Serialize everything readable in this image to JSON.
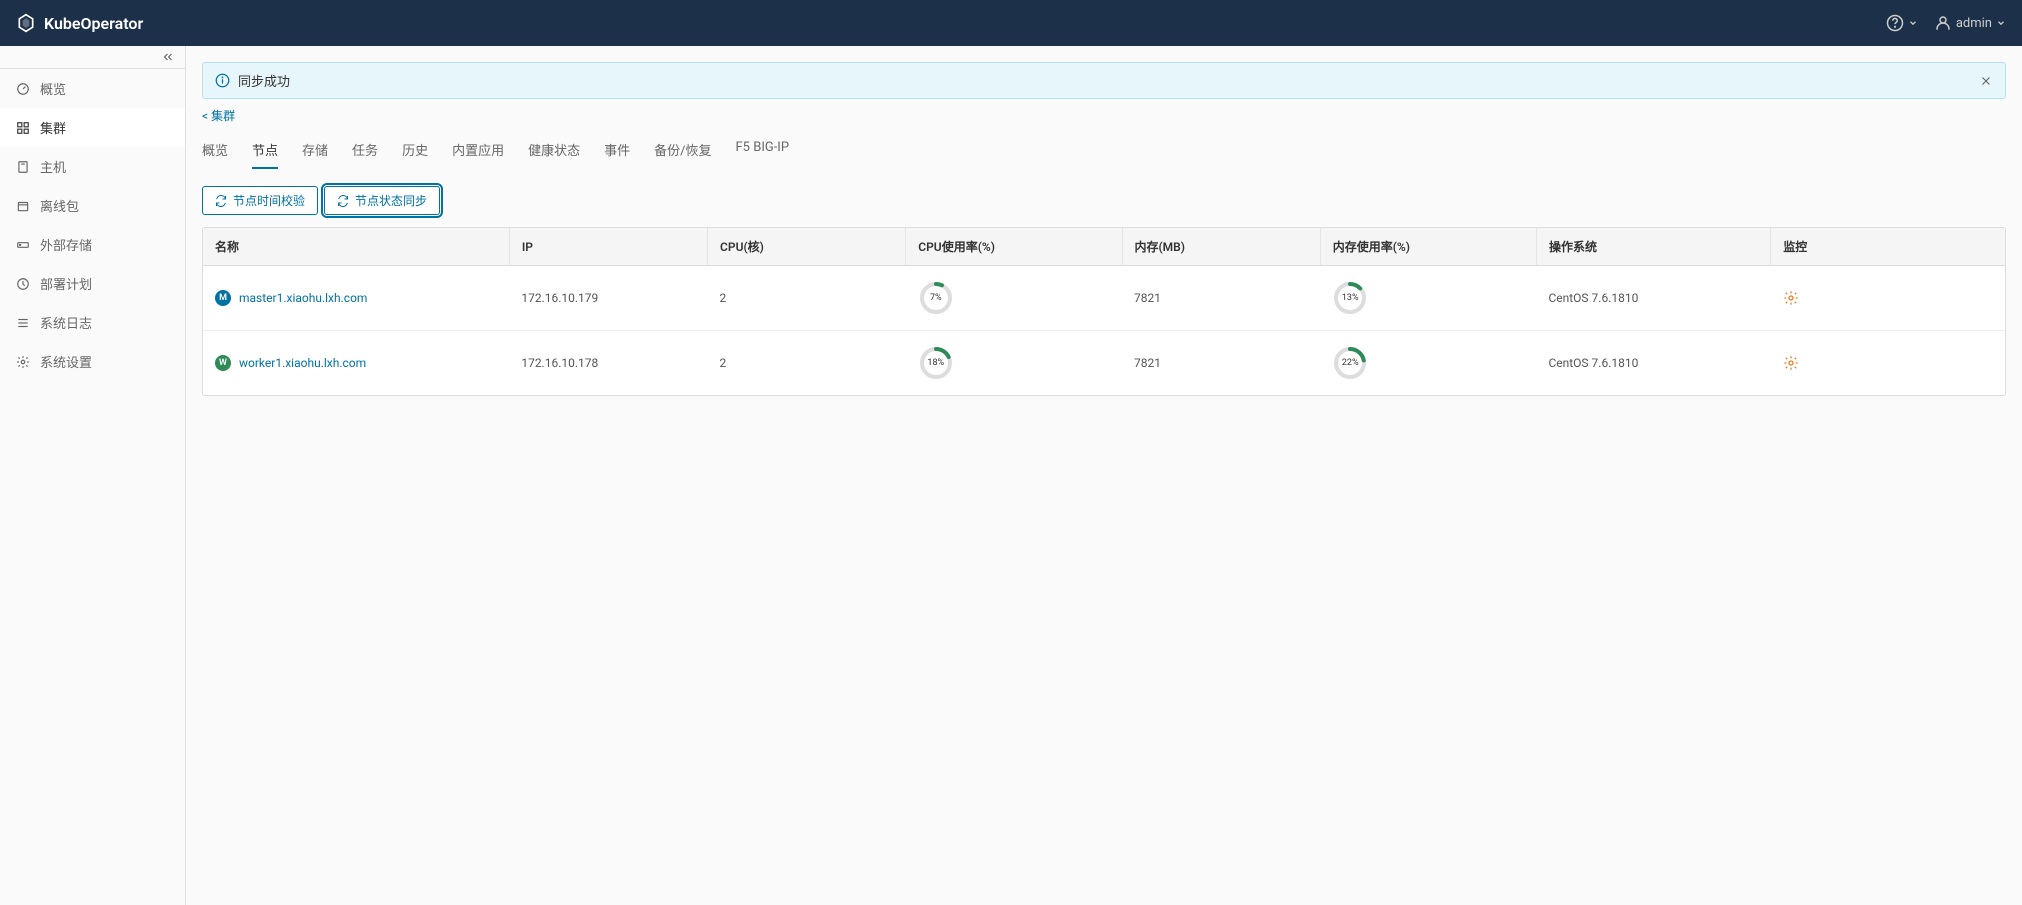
{
  "header": {
    "app_name": "KubeOperator",
    "user": "admin"
  },
  "sidebar": {
    "items": [
      {
        "label": "概览",
        "icon": "dashboard"
      },
      {
        "label": "集群",
        "icon": "cluster",
        "active": true
      },
      {
        "label": "主机",
        "icon": "host"
      },
      {
        "label": "离线包",
        "icon": "package"
      },
      {
        "label": "外部存储",
        "icon": "storage"
      },
      {
        "label": "部署计划",
        "icon": "plan"
      },
      {
        "label": "系统日志",
        "icon": "log"
      },
      {
        "label": "系统设置",
        "icon": "settings"
      }
    ]
  },
  "alert": {
    "message": "同步成功"
  },
  "breadcrumb": {
    "back_label": "< 集群"
  },
  "tabs": [
    {
      "label": "概览"
    },
    {
      "label": "节点",
      "active": true
    },
    {
      "label": "存储"
    },
    {
      "label": "任务"
    },
    {
      "label": "历史"
    },
    {
      "label": "内置应用"
    },
    {
      "label": "健康状态"
    },
    {
      "label": "事件"
    },
    {
      "label": "备份/恢复"
    },
    {
      "label": "F5 BIG-IP"
    }
  ],
  "actions": {
    "time_check": "节点时间校验",
    "status_sync": "节点状态同步"
  },
  "table": {
    "headers": {
      "name": "名称",
      "ip": "IP",
      "cpu": "CPU(核)",
      "cpu_usage": "CPU使用率(%)",
      "memory": "内存(MB)",
      "memory_usage": "内存使用率(%)",
      "os": "操作系统",
      "monitor": "监控"
    },
    "rows": [
      {
        "badge": "M",
        "badge_class": "badge-m",
        "name": "master1.xiaohu.lxh.com",
        "ip": "172.16.10.179",
        "cpu": "2",
        "cpu_usage": 7,
        "cpu_usage_text": "7%",
        "memory": "7821",
        "memory_usage": 13,
        "memory_usage_text": "13%",
        "os": "CentOS 7.6.1810"
      },
      {
        "badge": "W",
        "badge_class": "badge-w",
        "name": "worker1.xiaohu.lxh.com",
        "ip": "172.16.10.178",
        "cpu": "2",
        "cpu_usage": 18,
        "cpu_usage_text": "18%",
        "memory": "7821",
        "memory_usage": 22,
        "memory_usage_text": "22%",
        "os": "CentOS 7.6.1810"
      }
    ]
  }
}
